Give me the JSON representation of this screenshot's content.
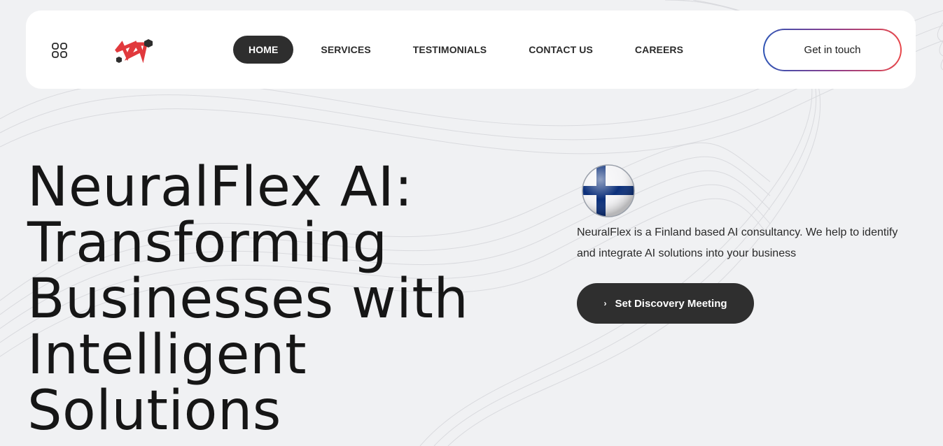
{
  "brand": {
    "logo_icon": "neuralflex-logo-icon",
    "colors": {
      "logo_red": "#e1393d",
      "logo_dark": "#2e2e2e",
      "accent_blue": "#2f55b5",
      "accent_red": "#e8474a"
    }
  },
  "header": {
    "menu_icon": "grid-menu-icon",
    "nav": {
      "home": "HOME",
      "services": "SERVICES",
      "testimonials": "TESTIMONIALS",
      "contact": "CONTACT US",
      "careers": "CAREERS"
    },
    "active_item": "HOME",
    "cta_label": "Get in touch"
  },
  "hero": {
    "title_lines": [
      "NeuralFlex AI:",
      "Transforming",
      "Businesses with",
      "Intelligent",
      "Solutions"
    ],
    "flag_icon": "finland-flag-icon",
    "description_lines": [
      "NeuralFlex is a Finland based AI consultancy. We help to identify",
      "and integrate AI solutions into your business"
    ],
    "primary_button_label": "Set Discovery Meeting",
    "primary_button_icon": "chevron-right-icon"
  }
}
